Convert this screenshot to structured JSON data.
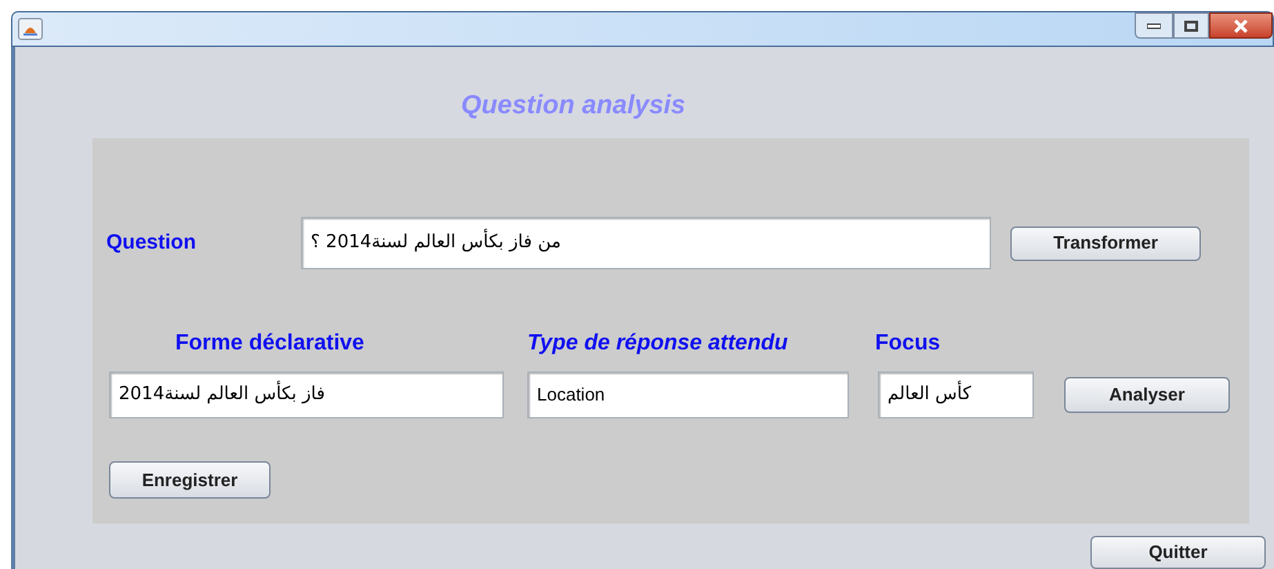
{
  "window": {
    "heading": "Question analysis"
  },
  "question": {
    "label": "Question",
    "value": "من فاز بكأس العالم لسنة2014 ؟",
    "button": "Transformer"
  },
  "analysis": {
    "declarative_form": {
      "label": "Forme déclarative",
      "value": "فاز بكأس العالم لسنة2014"
    },
    "answer_type": {
      "label": "Type de réponse attendu",
      "value": "Location"
    },
    "focus": {
      "label": "Focus",
      "value": "كأس العالم"
    },
    "button": "Analyser"
  },
  "save_button": "Enregistrer",
  "quit_button": "Quitter"
}
